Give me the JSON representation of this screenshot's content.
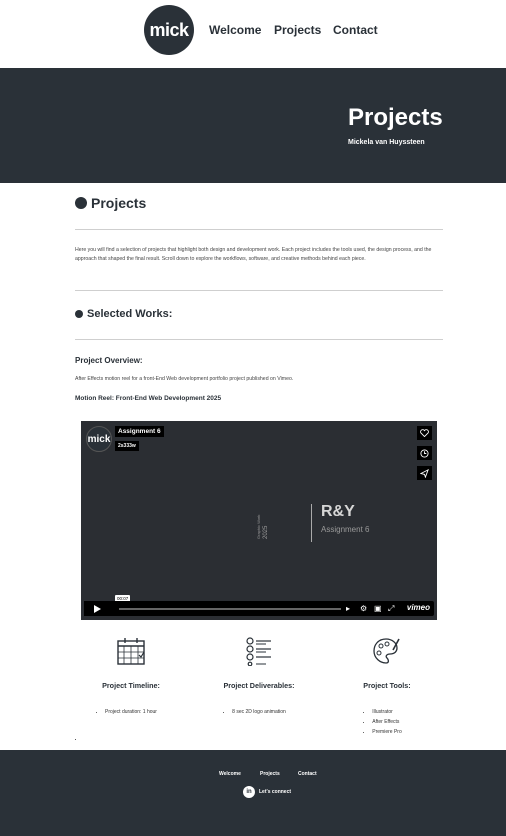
{
  "header": {
    "logo_text": "mick",
    "nav": [
      "Welcome",
      "Projects",
      "Contact"
    ]
  },
  "hero": {
    "title": "Projects",
    "subtitle": "Mickela van Huyssteen"
  },
  "main": {
    "heading": "Projects",
    "intro": "Here you will find a selection of projects that highlight both design and development work. Each project includes the tools used, the design process, and the approach that shaped the final result. Scroll down to explore the workflows, software, and creative methods behind each piece.",
    "selected_works": "Selected Works:",
    "overview_heading": "Project Overview:",
    "overview_text": "After Effects motion reel for a front-End Web development portfolio project published on Vimeo.",
    "reel_heading": "Motion Reel: Front-End Web Development 2025"
  },
  "video": {
    "logo_text": "mick",
    "title": "Assignment 6",
    "size": "2s333w",
    "vertical_top": "Graphic Work",
    "vertical_bottom": "2025",
    "brand": "R&Y",
    "subtitle": "Assignment 6",
    "time": "00:07",
    "player": "vimeo",
    "side_icons": [
      "heart-icon",
      "clock-icon",
      "send-icon"
    ]
  },
  "columns": [
    {
      "icon": "calendar-icon",
      "heading": "Project Timeline:",
      "items": [
        "Project duration: 1 hour"
      ]
    },
    {
      "icon": "checklist-icon",
      "heading": "Project Deliverables:",
      "items": [
        "8 sec 2D logo animation"
      ]
    },
    {
      "icon": "palette-icon",
      "heading": "Project Tools:",
      "items": [
        "Illustrator",
        "After Effects",
        "Premiere Pro"
      ]
    }
  ],
  "footer": {
    "links": [
      "Welcome",
      "Projects",
      "Contact"
    ],
    "connect": "Let's connect",
    "linkedin_glyph": "in"
  },
  "colors": {
    "dark": "#2a3138",
    "white": "#ffffff",
    "video_bg": "#2b2e33"
  }
}
